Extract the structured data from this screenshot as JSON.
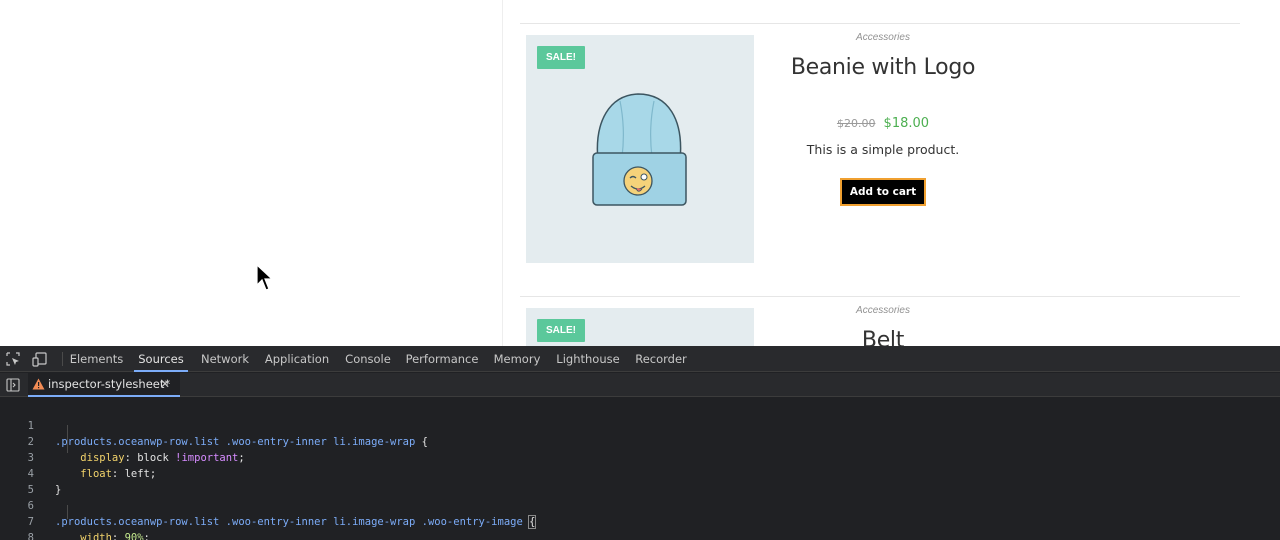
{
  "page": {
    "products": [
      {
        "sale_badge": "SALE!",
        "category": "Accessories",
        "title": "Beanie with Logo",
        "price_old": "$20.00",
        "price_new": "$18.00",
        "description": "This is a simple product.",
        "add_to_cart_label": "Add to cart"
      },
      {
        "sale_badge": "SALE!",
        "category": "Accessories",
        "title": "Belt"
      }
    ]
  },
  "devtools": {
    "tabs": [
      {
        "label": "Elements",
        "active": false
      },
      {
        "label": "Sources",
        "active": true
      },
      {
        "label": "Network",
        "active": false
      },
      {
        "label": "Application",
        "active": false
      },
      {
        "label": "Console",
        "active": false
      },
      {
        "label": "Performance",
        "active": false
      },
      {
        "label": "Memory",
        "active": false
      },
      {
        "label": "Lighthouse",
        "active": false
      },
      {
        "label": "Recorder",
        "active": false
      }
    ],
    "file_tab": {
      "name": "inspector-stylesheet*",
      "close": "✕"
    },
    "code": {
      "line_numbers": [
        "1",
        "2",
        "3",
        "4",
        "5",
        "6",
        "7",
        "8"
      ],
      "rule1_selector": ".products.oceanwp-row.list .woo-entry-inner li.image-wrap",
      "rule1_decl1_prop": "display",
      "rule1_decl1_value": "block",
      "rule1_decl1_important": "!important",
      "rule1_decl2_prop": "float",
      "rule1_decl2_value": "left",
      "rule2_selector": ".products.oceanwp-row.list .woo-entry-inner li.image-wrap .woo-entry-image",
      "rule2_decl1_prop": "width",
      "rule2_decl1_value": "90%"
    }
  },
  "colors": {
    "accent_sale": "#5bc89b",
    "price_new": "#4caf50",
    "button_border": "#f0a030",
    "devtools_bg": "#202124",
    "devtools_active_tab": "#7cacf8"
  }
}
